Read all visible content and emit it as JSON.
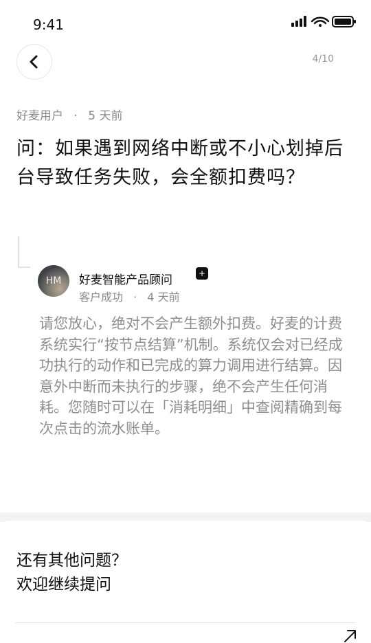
{
  "status_bar": {
    "time": "9:41",
    "icons": [
      "signal-icon",
      "wifi-icon",
      "battery-icon"
    ]
  },
  "header": {
    "back_icon": "chevron-left-icon",
    "page_indicator": "4/10"
  },
  "question": {
    "author": "好麦用户",
    "separator": "·",
    "time_ago": "5 天前",
    "title": "问：如果遇到网络中断或不小心划掉后台导致任务失败，会全额扣费吗？"
  },
  "answer": {
    "avatar_initials": "HM",
    "author_name": "好麦智能产品顾问",
    "badge": "+",
    "role": "客户成功",
    "separator": "·",
    "time_ago": "4 天前",
    "body": "请您放心，绝对不会产生额外扣费。好麦的计费系统实行“按节点结算”机制。系统仅会对已经成功执行的动作和已完成的算力调用进行结算。因意外中断而未执行的步骤，绝不会产生任何消耗。您随时可以在「消耗明细」中查阅精确到每次点击的流水账单。"
  },
  "followup": {
    "line1": "还有其他问题？",
    "line2": "欢迎继续提问",
    "arrow_icon": "arrow-up-right-icon"
  }
}
